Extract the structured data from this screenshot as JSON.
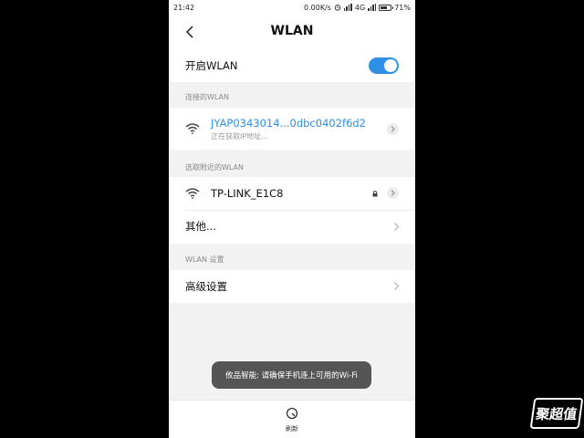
{
  "status": {
    "time": "21:42",
    "speed": "0.00K/s",
    "network": "4G",
    "battery": "71%",
    "battery_level": 0.71
  },
  "header": {
    "title": "WLAN"
  },
  "wlan_toggle": {
    "label": "开启WLAN",
    "on": true
  },
  "connected_section": {
    "header": "连接的WLAN",
    "network": {
      "ssid": "JYAP0343014...0dbc0402f6d2",
      "status": "正在获取IP地址..."
    }
  },
  "nearby_section": {
    "header": "选取附近的WLAN",
    "networks": [
      {
        "ssid": "TP-LINK_E1C8",
        "locked": true
      }
    ],
    "other_label": "其他..."
  },
  "settings_section": {
    "header": "WLAN 设置",
    "advanced_label": "高级设置"
  },
  "toast": {
    "text": "攸品智能: 请确保手机连上可用的Wi-Fi"
  },
  "bottom": {
    "refresh_label": "刷新"
  },
  "watermark": {
    "text": "聚超值"
  },
  "colors": {
    "accent": "#2e8fe6",
    "toggle_on": "#2e8fe6"
  }
}
